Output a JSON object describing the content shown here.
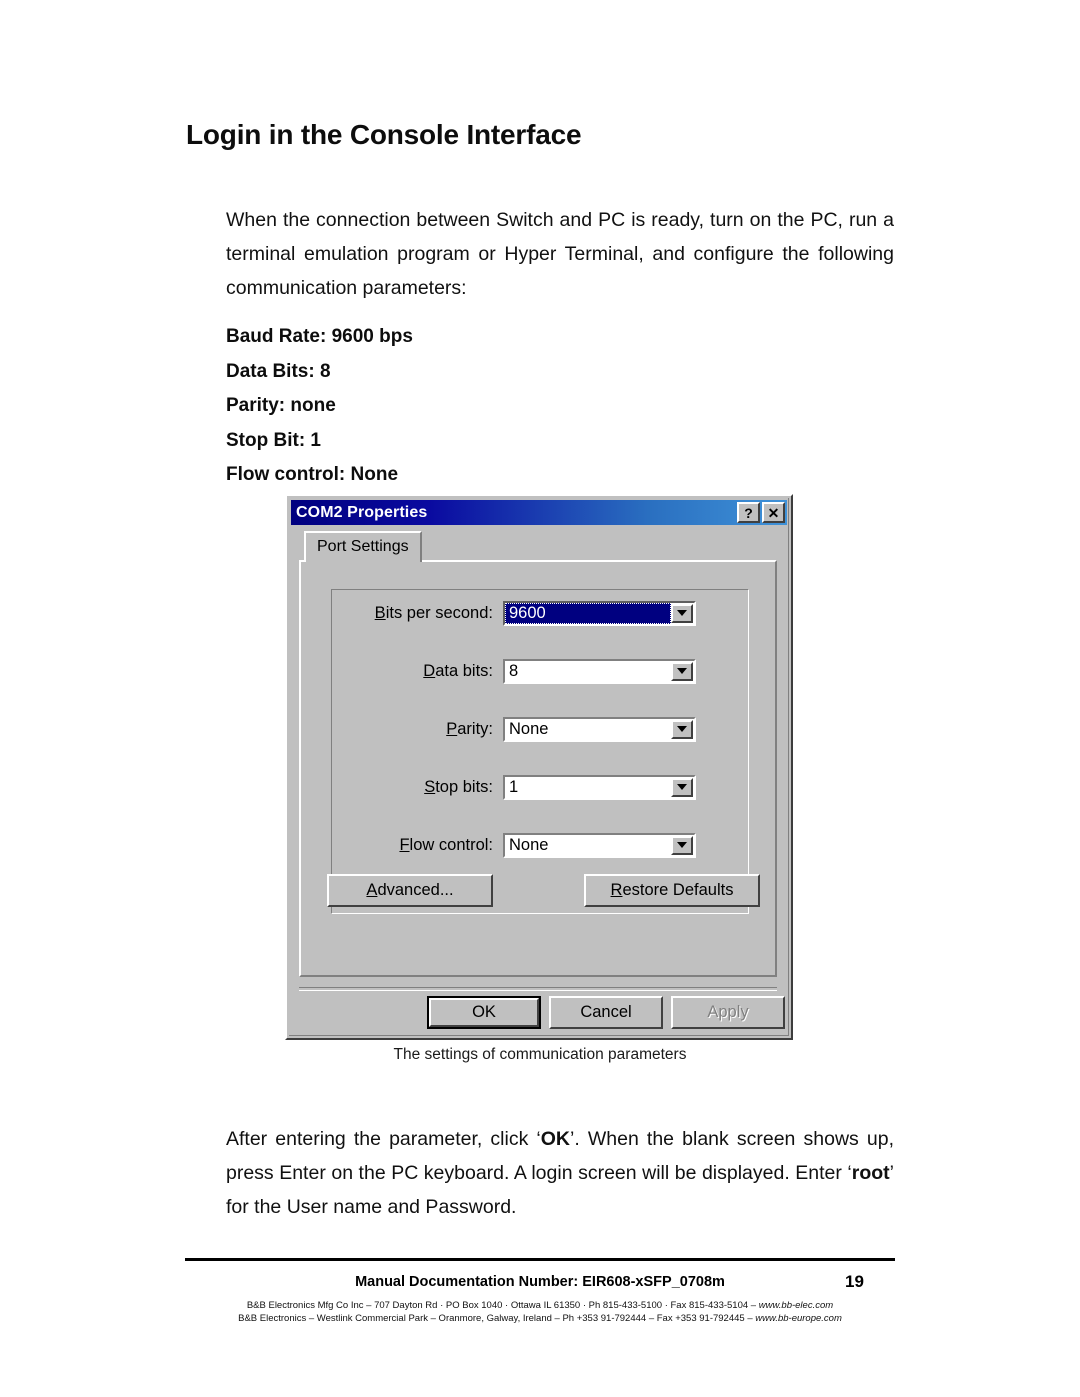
{
  "document": {
    "heading": "Login in the Console Interface",
    "intro_paragraph": "When the connection between Switch and PC is ready, turn on the PC, run a terminal emulation program or Hyper Terminal, and configure the following communication parameters:",
    "parameters": [
      "Baud Rate: 9600 bps",
      "Data Bits: 8",
      "Parity: none",
      "Stop Bit: 1",
      "Flow control: None"
    ],
    "figure_caption": "The settings of communication parameters",
    "outro_paragraph_parts": {
      "p1": "After entering the parameter, click ‘",
      "bold1": "OK",
      "p2": "’. When the blank screen shows up, press Enter on the PC keyboard. A login screen will be displayed. Enter ‘",
      "bold2": "root",
      "p3": "’ for the User name and Password."
    }
  },
  "dialog": {
    "title": "COM2 Properties",
    "help_button": "?",
    "close_button": "✕",
    "tab_label": "Port Settings",
    "fields": [
      {
        "label_accel": "B",
        "label_rest": "its per second:",
        "value": "9600",
        "focused": true
      },
      {
        "label_accel": "D",
        "label_rest": "ata bits:",
        "value": "8",
        "focused": false
      },
      {
        "label_accel": "P",
        "label_rest": "arity:",
        "value": "None",
        "focused": false
      },
      {
        "label_accel": "S",
        "label_rest": "top bits:",
        "value": "1",
        "focused": false
      },
      {
        "label_accel": "F",
        "label_rest": "low control:",
        "value": "None",
        "focused": false
      }
    ],
    "buttons": {
      "advanced_accel": "A",
      "advanced_rest": "dvanced...",
      "restore_accel": "R",
      "restore_rest": "estore Defaults",
      "ok": "OK",
      "cancel": "Cancel",
      "apply": "Apply"
    },
    "colors": {
      "face": "#c0c0c0",
      "title_gradient_start": "#00007f",
      "title_gradient_end": "#3f92d8",
      "selection": "#000080"
    }
  },
  "footer": {
    "doc_number": "Manual Documentation Number: EIR608-xSFP_0708m",
    "page_number": "19",
    "address_line1_plain": "B&B Electronics Mfg Co Inc – 707 Dayton Rd · PO Box 1040 · Ottawa IL 61350 · Ph 815-433-5100 · Fax 815-433-5104 – ",
    "address_line1_url": "www.bb-elec.com",
    "address_line2_plain": "B&B Electronics – Westlink Commercial Park – Oranmore, Galway, Ireland – Ph +353 91-792444 – Fax +353 91-792445 – ",
    "address_line2_url": "www.bb-europe.com"
  }
}
